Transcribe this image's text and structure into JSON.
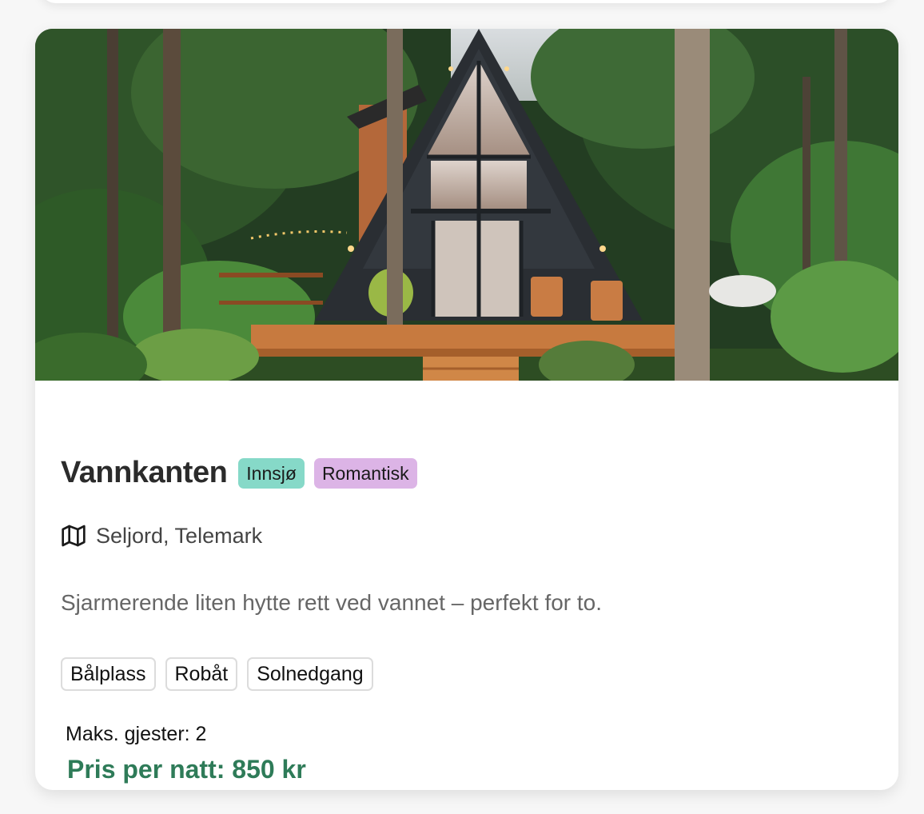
{
  "listing": {
    "name": "Vannkanten",
    "tags": [
      "Innsjø",
      "Romantisk"
    ],
    "location": "Seljord, Telemark",
    "description": "Sjarmerende liten hytte rett ved vannet – perfekt for to.",
    "features": [
      "Bålplass",
      "Robåt",
      "Solnedgang"
    ],
    "max_guests": "Maks. gjester: 2",
    "price": "Pris per natt: 850 kr"
  },
  "icons": {
    "location": "map-icon"
  },
  "colors": {
    "tag_innsjo": "#86d9c8",
    "tag_romantisk": "#dcb4e6",
    "price": "#2e7b58"
  }
}
